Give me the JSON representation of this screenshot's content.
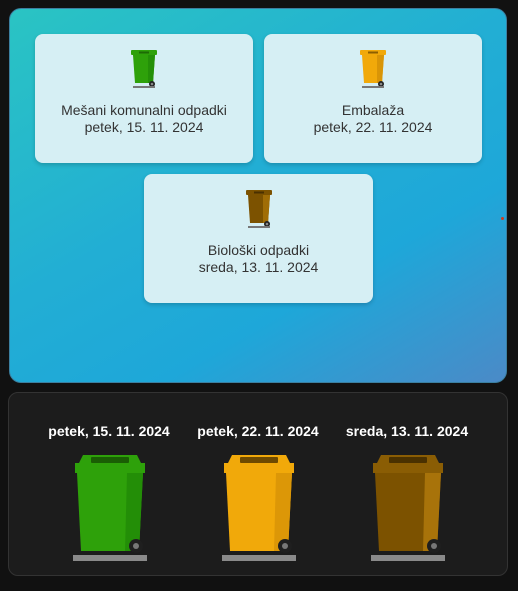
{
  "tiles": [
    {
      "type": "Mešani komunalni odpadki",
      "date": "petek, 15. 11. 2024",
      "icon": "green-bin-icon",
      "color": "#2ea10a"
    },
    {
      "type": "Embalaža",
      "date": "petek, 22. 11. 2024",
      "icon": "yellow-bin-icon",
      "color": "#f1a90a"
    },
    {
      "type": "Biološki odpadki",
      "date": "sreda, 13. 11. 2024",
      "icon": "brown-bin-icon",
      "color": "#7c5200"
    }
  ],
  "bottom": [
    {
      "date": "petek, 15. 11. 2024",
      "icon": "green-bin-icon",
      "color": "#2ea10a"
    },
    {
      "date": "petek, 22. 11. 2024",
      "icon": "yellow-bin-icon",
      "color": "#f1a90a"
    },
    {
      "date": "sreda, 13. 11. 2024",
      "icon": "brown-bin-icon",
      "color": "#7c5200"
    }
  ]
}
